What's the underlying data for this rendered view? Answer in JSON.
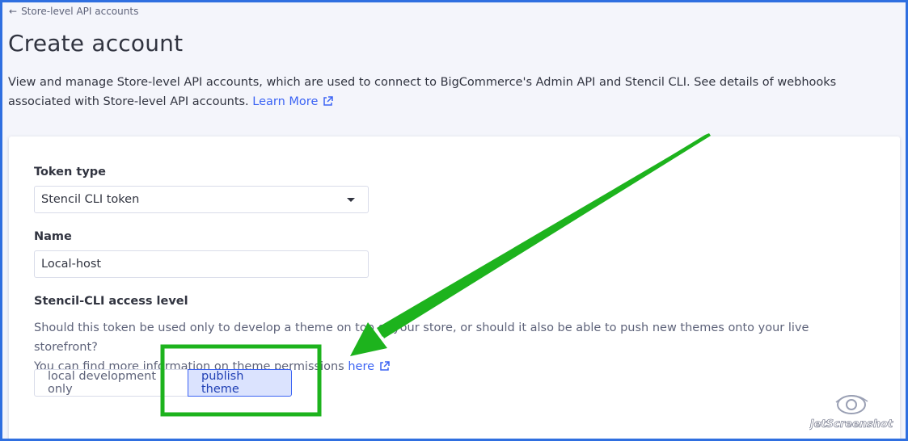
{
  "header": {
    "back_label": "Store-level API accounts",
    "title": "Create account",
    "description": "View and manage Store-level API accounts, which are used to connect to BigCommerce's Admin API and Stencil CLI. See details of webhooks associated with Store-level API accounts.",
    "learn_more": "Learn More"
  },
  "form": {
    "token_type_label": "Token type",
    "token_type_value": "Stencil CLI token",
    "name_label": "Name",
    "name_value": "Local-host",
    "access_label": "Stencil-CLI access level",
    "access_help_1": "Should this token be used only to develop a theme on top of your store, or should it also be able to push new themes onto your live storefront?",
    "access_help_2": "You can find more information on theme permissions",
    "access_help_link": "here",
    "options": [
      "local development only",
      "publish theme"
    ],
    "selected_option": "publish theme"
  },
  "icons": {
    "back": "arrow-left-icon",
    "external": "external-link-icon",
    "dropdown": "caret-down-icon"
  },
  "colors": {
    "link": "#3c64f4",
    "selected_bg": "#dbe3fe",
    "annotation": "#1db31d",
    "frame": "#2f6fe0"
  },
  "watermark": {
    "text": "JetScreenshot"
  }
}
